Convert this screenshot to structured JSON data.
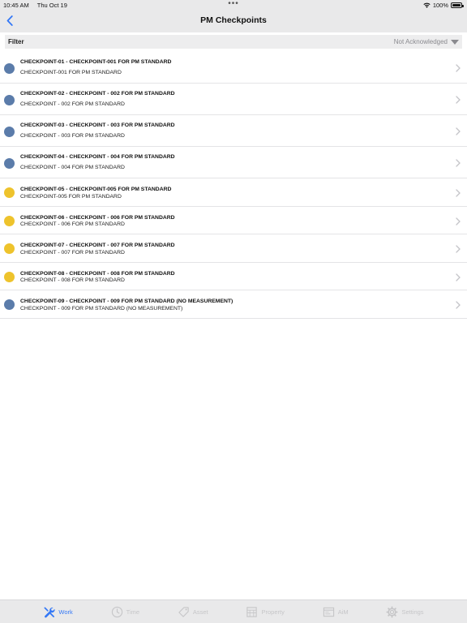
{
  "status_bar": {
    "time": "10:45 AM",
    "date": "Thu Oct 19",
    "battery": "100%",
    "battery_level": 1.0
  },
  "nav": {
    "title": "PM Checkpoints",
    "back_icon": "chevron-left-icon"
  },
  "filter": {
    "label": "Filter",
    "value": "Not Acknowledged"
  },
  "colors": {
    "accent": "#3478f6",
    "blue_status": "#5b7caa",
    "yellow_status": "#eec32c"
  },
  "checkpoints": [
    {
      "title": "CHECKPOINT-01 - CHECKPOINT-001 FOR PM STANDARD",
      "subtitle": "CHECKPOINT-001 FOR PM STANDARD",
      "status": "blue"
    },
    {
      "title": "CHECKPOINT-02 - CHECKPOINT - 002 FOR PM STANDARD",
      "subtitle": "CHECKPOINT - 002 FOR PM STANDARD",
      "status": "blue"
    },
    {
      "title": "CHECKPOINT-03 - CHECKPOINT - 003 FOR PM STANDARD",
      "subtitle": "CHECKPOINT - 003 FOR PM STANDARD",
      "status": "blue"
    },
    {
      "title": "CHECKPOINT-04 - CHECKPOINT - 004 FOR PM STANDARD",
      "subtitle": "CHECKPOINT - 004 FOR PM STANDARD",
      "status": "blue"
    },
    {
      "title": "CHECKPOINT-05 - CHECKPOINT-005 FOR PM STANDARD",
      "subtitle": "CHECKPOINT-005 FOR PM STANDARD",
      "status": "yellow"
    },
    {
      "title": "CHECKPOINT-06 - CHECKPOINT - 006 FOR PM STANDARD",
      "subtitle": "CHECKPOINT - 006 FOR PM STANDARD",
      "status": "yellow"
    },
    {
      "title": "CHECKPOINT-07 - CHECKPOINT - 007 FOR PM STANDARD",
      "subtitle": "CHECKPOINT - 007 FOR PM STANDARD",
      "status": "yellow"
    },
    {
      "title": "CHECKPOINT-08 - CHECKPOINT - 008 FOR PM STANDARD",
      "subtitle": "CHECKPOINT - 008 FOR PM STANDARD",
      "status": "yellow"
    },
    {
      "title": "CHECKPOINT-09 - CHECKPOINT - 009 FOR PM STANDARD (NO MEASUREMENT)",
      "subtitle": "CHECKPOINT - 009 FOR PM STANDARD (NO MEASUREMENT)",
      "status": "blue"
    }
  ],
  "tabs": [
    {
      "label": "Work",
      "icon": "wrench-icon",
      "active": true
    },
    {
      "label": "Time",
      "icon": "clock-icon",
      "active": false
    },
    {
      "label": "Asset",
      "icon": "tag-icon",
      "active": false
    },
    {
      "label": "Property",
      "icon": "building-icon",
      "active": false
    },
    {
      "label": "AiM",
      "icon": "window-icon",
      "active": false
    },
    {
      "label": "Settings",
      "icon": "gear-icon",
      "active": false
    }
  ]
}
